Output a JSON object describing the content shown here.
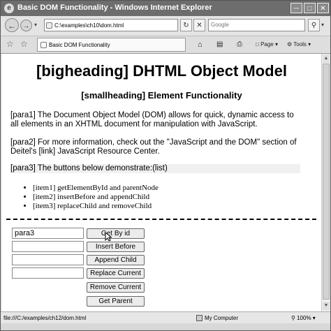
{
  "window": {
    "title": "Basic DOM Functionality - Windows Internet Explorer",
    "minimize_glyph": "─",
    "maximize_glyph": "□",
    "close_glyph": "✕"
  },
  "addressbar": {
    "url": "C:\\examples\\ch10\\dom.html",
    "search_placeholder": "Google"
  },
  "tab": {
    "label": "Basic DOM Functionality"
  },
  "commands": {
    "page": "Page",
    "tools": "Tools"
  },
  "content": {
    "bigheading": "[bigheading] DHTML Object Model",
    "smallheading": "[smallheading] Element Functionality",
    "para1": "[para1] The Document Object Model (DOM) allows for quick, dynamic access to all elements in an XHTML document for manipulation with JavaScript.",
    "para2": "[para2] For more information, check out the \"JavaScript and the DOM\" section of Deitel's [link] JavaScript Resource Center.",
    "para3": "[para3] The buttons below demonstrate:(list)",
    "items": [
      "[item1] getElementById and parentNode",
      "[item2] insertBefore and appendChild",
      "[item3] replaceChild and removeChild"
    ]
  },
  "controls": {
    "fields": [
      "para3",
      "",
      "",
      ""
    ],
    "buttons": [
      "Get By id",
      "Insert Before",
      "Append Child",
      "Replace Current",
      "Remove Current",
      "Get Parent"
    ]
  },
  "statusbar": {
    "path": "file:///C:/examples/ch12/dom.html",
    "zone": "My Computer",
    "zoom": "100%"
  },
  "colors": {
    "titlebar": "#6d6d6d",
    "chrome": "#e4e4e4",
    "content_bg": "#ffffff",
    "para3_highlight": "#f0f0f0"
  }
}
